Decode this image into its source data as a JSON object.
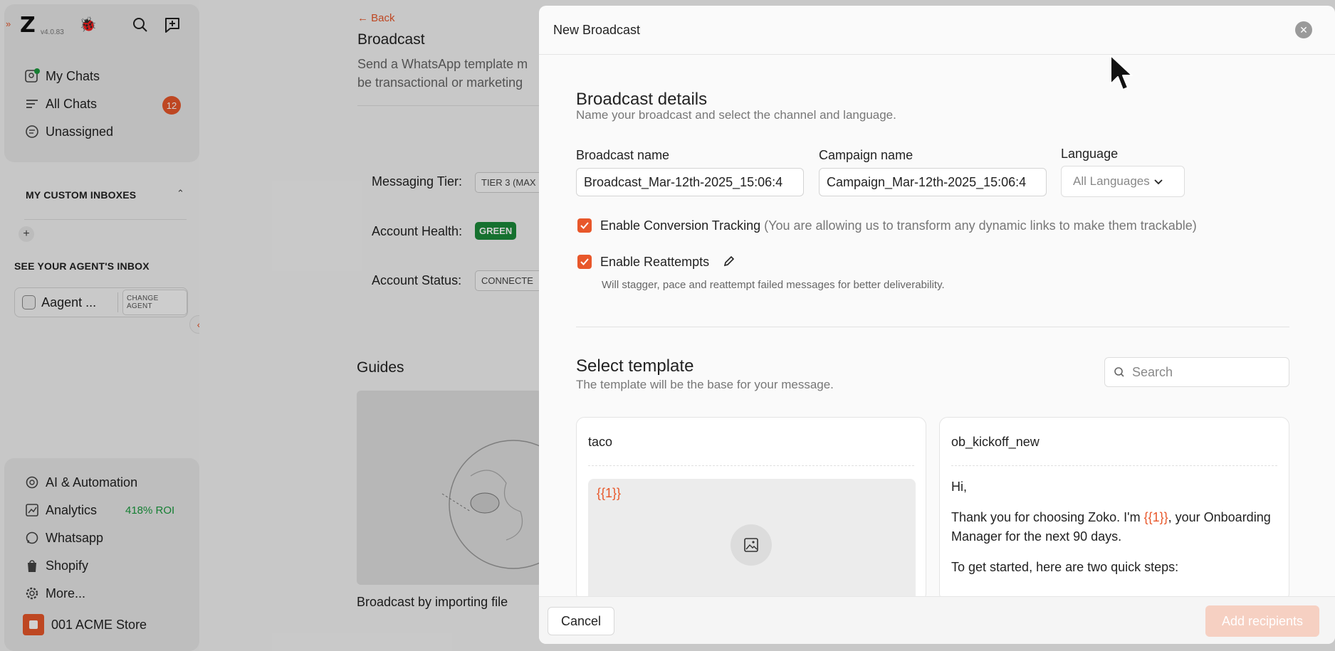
{
  "app": {
    "version": "v4.0.83"
  },
  "sidebar": {
    "nav": [
      {
        "label": "My Chats",
        "icon": "user-chat-icon"
      },
      {
        "label": "All Chats",
        "icon": "list-icon",
        "badge": "12"
      },
      {
        "label": "Unassigned",
        "icon": "chat-bubble-icon"
      }
    ],
    "custom_inboxes_heading": "MY CUSTOM INBOXES",
    "agent_inbox_heading": "SEE YOUR AGENT'S INBOX",
    "agent_name": "Aagent ...",
    "change_agent_label": "CHANGE AGENT",
    "bottom_nav": [
      {
        "label": "AI & Automation",
        "icon": "ai-icon"
      },
      {
        "label": "Analytics",
        "icon": "analytics-icon",
        "extra": "418% ROI"
      },
      {
        "label": "Whatsapp",
        "icon": "whatsapp-icon"
      },
      {
        "label": "Shopify",
        "icon": "shopify-icon"
      },
      {
        "label": "More...",
        "icon": "gear-icon"
      }
    ],
    "store_name": "001 ACME Store"
  },
  "page": {
    "back_label": "← Back",
    "title": "Broadcast",
    "subtitle_line1": "Send a WhatsApp template m",
    "subtitle_line2": "be transactional or marketing",
    "messaging_tier_label": "Messaging Tier:",
    "messaging_tier_value": "TIER 3 (MAX",
    "account_health_label": "Account Health:",
    "account_health_value": "GREEN",
    "account_status_label": "Account Status:",
    "account_status_value": "CONNECTE",
    "guides_heading": "Guides",
    "guide_caption": "Broadcast by importing file"
  },
  "modal": {
    "title": "New Broadcast",
    "details_title": "Broadcast details",
    "details_subtitle": "Name your broadcast and select the channel and language.",
    "broadcast_name_label": "Broadcast name",
    "broadcast_name_value": "Broadcast_Mar-12th-2025_15:06:4",
    "campaign_name_label": "Campaign name",
    "campaign_name_value": "Campaign_Mar-12th-2025_15:06:4",
    "language_label": "Language",
    "language_value": "All Languages",
    "conversion_label": "Enable Conversion Tracking",
    "conversion_note": "(You are allowing us to transform any dynamic links to make them trackable)",
    "reattempts_label": "Enable Reattempts",
    "reattempts_note": "Will stagger, pace and reattempt failed messages for better deliverability.",
    "template_title": "Select template",
    "template_subtitle": "The template will be the base for your message.",
    "search_placeholder": "Search",
    "templates": [
      {
        "name": "taco",
        "variable": "{{1}}"
      },
      {
        "name": "ob_kickoff_new",
        "greeting": "Hi,",
        "line_before_var": "Thank you for choosing Zoko. I'm ",
        "variable": "{{1}}",
        "line_after_var": ", your Onboarding Manager for the next 90 days.",
        "steps_line": "To get started, here are two quick steps:"
      }
    ],
    "cancel_label": "Cancel",
    "add_recipients_label": "Add recipients"
  }
}
